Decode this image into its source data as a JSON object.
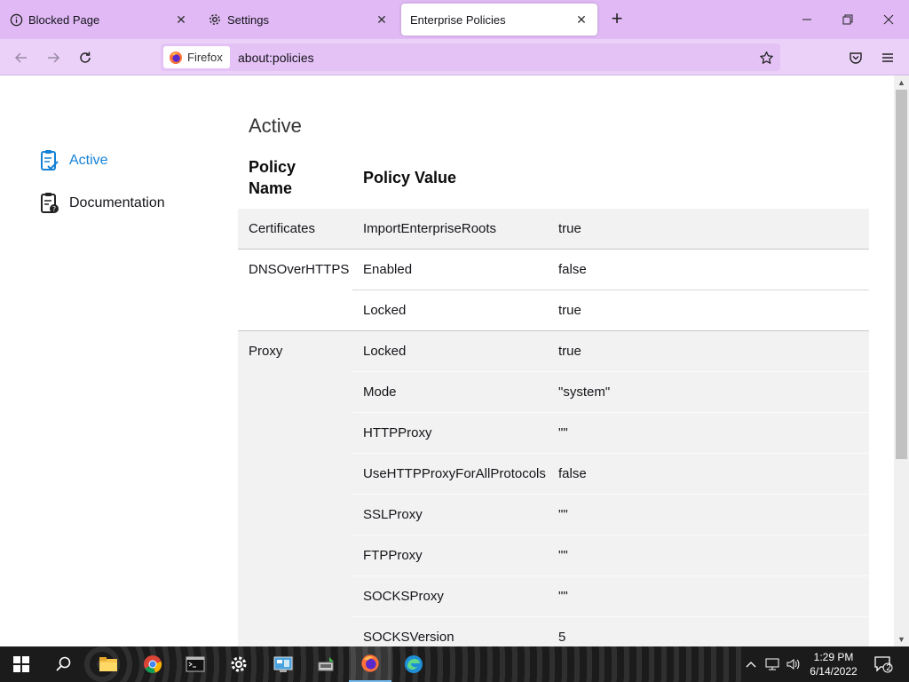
{
  "tabs": [
    {
      "label": "Blocked Page",
      "icon": "info-icon",
      "selected": false
    },
    {
      "label": "Settings",
      "icon": "gear-icon",
      "selected": false
    },
    {
      "label": "Enterprise Policies",
      "icon": "",
      "selected": true
    }
  ],
  "navbar": {
    "identity_label": "Firefox",
    "url": "about:policies"
  },
  "sidebar": {
    "items": [
      {
        "label": "Active",
        "icon": "clipboard-check-icon",
        "active": true
      },
      {
        "label": "Documentation",
        "icon": "clipboard-help-icon",
        "active": false
      }
    ]
  },
  "main": {
    "heading": "Active",
    "col_policy_name": "Policy Name",
    "col_policy_value": "Policy Value",
    "rows": [
      {
        "name": "Certificates",
        "key": "ImportEnterpriseRoots",
        "value": "true"
      },
      {
        "name": "DNSOverHTTPS",
        "key": "Enabled",
        "value": "false"
      },
      {
        "name": "",
        "key": "Locked",
        "value": "true"
      },
      {
        "name": "Proxy",
        "key": "Locked",
        "value": "true"
      },
      {
        "name": "",
        "key": "Mode",
        "value": "\"system\""
      },
      {
        "name": "",
        "key": "HTTPProxy",
        "value": "\"\""
      },
      {
        "name": "",
        "key": "UseHTTPProxyForAllProtocols",
        "value": "false"
      },
      {
        "name": "",
        "key": "SSLProxy",
        "value": "\"\""
      },
      {
        "name": "",
        "key": "FTPProxy",
        "value": "\"\""
      },
      {
        "name": "",
        "key": "SOCKSProxy",
        "value": "\"\""
      },
      {
        "name": "",
        "key": "SOCKSVersion",
        "value": "5"
      }
    ]
  },
  "taskbar": {
    "apps": [
      "start-icon",
      "search-icon",
      "file-explorer-icon",
      "chrome-icon",
      "terminal-icon",
      "settings-gear-icon",
      "control-panel-icon",
      "network-tool-icon",
      "firefox-icon",
      "edge-icon"
    ],
    "clock_time": "1:29 PM",
    "clock_date": "6/14/2022",
    "notification_count": "2"
  },
  "colors": {
    "tabstrip": "#e0b9f5",
    "navbar": "#ebd1f8",
    "accent": "#1582d6"
  }
}
